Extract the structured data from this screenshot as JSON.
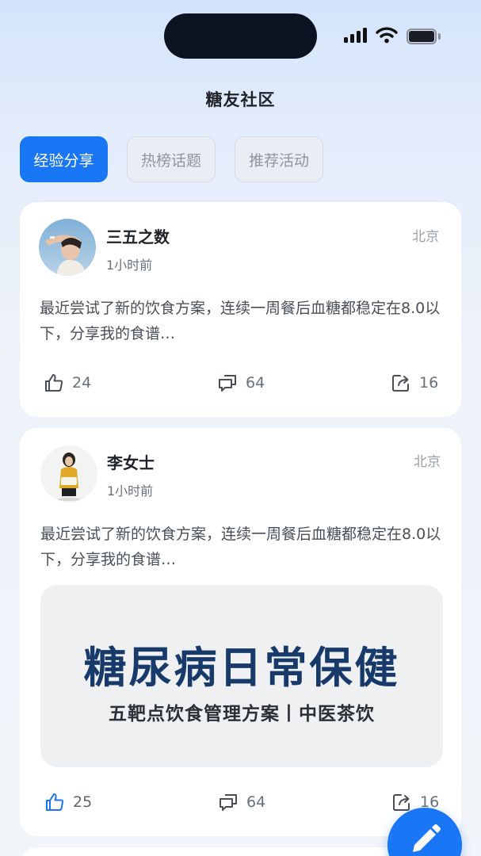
{
  "header": {
    "title": "糖友社区"
  },
  "tabs": [
    {
      "label": "经验分享",
      "active": true
    },
    {
      "label": "热榜话题",
      "active": false
    },
    {
      "label": "推荐活动",
      "active": false
    }
  ],
  "posts": [
    {
      "author": "三五之数",
      "time": "1小时前",
      "location": "北京",
      "text": "最近尝试了新的饮食方案，连续一周餐后血糖都稳定在8.0以下，分享我的食谱…",
      "likes": "24",
      "comments": "64",
      "shares": "16",
      "liked": false
    },
    {
      "author": "李女士",
      "time": "1小时前",
      "location": "北京",
      "text": "最近尝试了新的饮食方案，连续一周餐后血糖都稳定在8.0以下，分享我的食谱…",
      "image": {
        "title": "糖尿病日常保健",
        "subtitle": "五靶点饮食管理方案丨中医茶饮"
      },
      "likes": "25",
      "comments": "64",
      "shares": "16",
      "liked": true
    }
  ],
  "icons": {
    "like": "thumbs-up-icon",
    "comment": "comment-icon",
    "share": "share-icon",
    "fab": "pencil-icon"
  },
  "colors": {
    "accent": "#1976f5",
    "banner_title": "#173a6b"
  }
}
